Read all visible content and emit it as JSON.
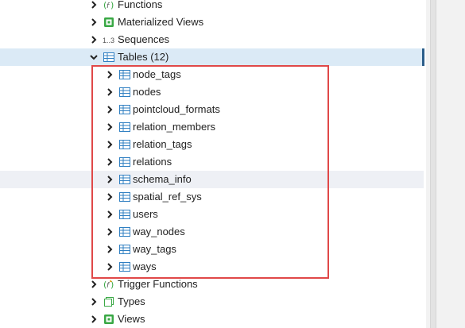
{
  "tree": {
    "parent_items": [
      {
        "label": "Functions",
        "icon": "functions-icon",
        "expanded": false
      },
      {
        "label": "Materialized Views",
        "icon": "materialized-views-icon",
        "expanded": false
      },
      {
        "label": "Sequences",
        "icon": "sequences-icon",
        "icon_text": "1..3",
        "expanded": false
      },
      {
        "label": "Tables (12)",
        "icon": "tables-icon",
        "expanded": true,
        "selected": true
      }
    ],
    "tables": [
      "node_tags",
      "nodes",
      "pointcloud_formats",
      "relation_members",
      "relation_tags",
      "relations",
      "schema_info",
      "spatial_ref_sys",
      "users",
      "way_nodes",
      "way_tags",
      "ways"
    ],
    "hovered_table": "schema_info",
    "after_items": [
      {
        "label": "Trigger Functions",
        "icon": "trigger-functions-icon",
        "expanded": false
      },
      {
        "label": "Types",
        "icon": "types-icon",
        "expanded": false
      },
      {
        "label": "Views",
        "icon": "views-icon",
        "expanded": false
      }
    ]
  },
  "colors": {
    "selected_row": "#dbeaf6",
    "hover_row": "#eef0f5",
    "highlight_border": "#e04848",
    "table_icon": "#2f7fc2",
    "green_icon": "#3aa845"
  }
}
